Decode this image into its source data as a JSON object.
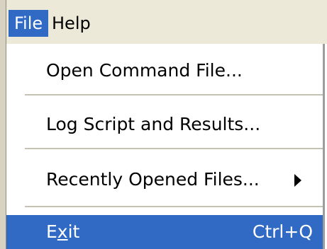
{
  "menubar": {
    "items": [
      {
        "label": "File",
        "active": true
      },
      {
        "label": "Help",
        "active": false
      }
    ]
  },
  "menu": {
    "items": [
      {
        "label": "Open Command File..."
      },
      {
        "label": "Log Script and Results..."
      },
      {
        "label": "Recently Opened Files...",
        "submenu": true
      },
      {
        "label_prefix": "E",
        "label_mnemonic": "x",
        "label_suffix": "it",
        "shortcut": "Ctrl+Q",
        "highlighted": true
      }
    ]
  },
  "colors": {
    "highlight": "#316ac5",
    "menubar_bg": "#ece9d8"
  }
}
